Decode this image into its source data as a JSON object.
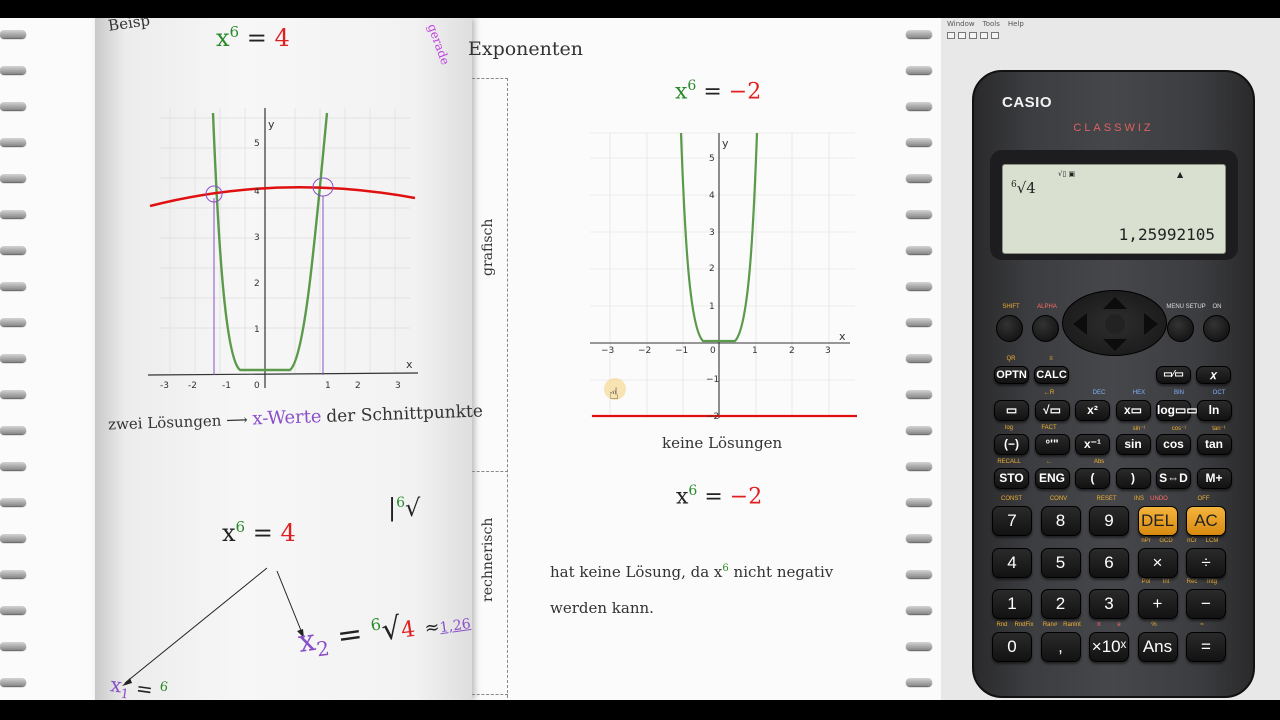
{
  "notebook": {
    "top_left_text": "Beisp",
    "vertical_header": "gerade",
    "header_right": "Exponenten",
    "left_equation": {
      "base": "x",
      "exp": "6",
      "eq": "=",
      "rhs": "4"
    },
    "left_caption_pre": "zwei Lösungen",
    "left_caption_highlight": "x-Werte",
    "left_caption_post": "der Schnittpunkte",
    "label_grafisch": "grafisch",
    "label_rechnerisch": "rechnerisch",
    "right_equation": {
      "base": "x",
      "exp": "6",
      "eq": "=",
      "rhs": "−2"
    },
    "right_caption": "keine Lösungen",
    "right_equation2": {
      "base": "x",
      "exp": "6",
      "eq": "=",
      "rhs": "−2"
    },
    "explanation_line1_a": "hat keine Lösung, da x",
    "explanation_line1_exp": "6",
    "explanation_line1_b": " nicht negativ",
    "explanation_line2": "werden kann.",
    "calc_work": {
      "eq_base": "x",
      "eq_exp": "6",
      "eq_eq": "=",
      "eq_rhs": "4",
      "root_index": "6",
      "x2_label": "x",
      "x2_sub": "2",
      "x2_eq": "=",
      "x2_root_index": "6",
      "x2_radicand": "4",
      "approx": "≈",
      "approx_value": "1,26",
      "x1_label": "x",
      "x1_sub": "1",
      "x1_eq": "=",
      "x1_frag": "6"
    },
    "graph_left": {
      "axis_x": "x",
      "axis_y": "y",
      "x_ticks": [
        "-3",
        "-2",
        "-1",
        "0",
        "1",
        "2",
        "3"
      ],
      "y_ticks": [
        "1",
        "2",
        "3",
        "4",
        "5"
      ]
    },
    "graph_right": {
      "axis_x": "x",
      "axis_y": "y",
      "x_ticks": [
        "−3",
        "−2",
        "−1",
        "0",
        "1",
        "2",
        "3"
      ],
      "y_ticks_pos": [
        "1",
        "2",
        "3",
        "4",
        "5"
      ],
      "y_ticks_neg": [
        "−1",
        "−2"
      ]
    }
  },
  "calculator_window": {
    "menu": [
      "Window",
      "Tools",
      "Help"
    ],
    "brand": "CASIO",
    "model": "CLASSWIZ",
    "display": {
      "indicators": "√▯ ▣",
      "arrow": "▲",
      "input_index": "6",
      "input_radical": "√4",
      "result": "1,25992105"
    },
    "top_labels": {
      "shift": "SHIFT",
      "alpha": "ALPHA",
      "menu": "MENU SETUP",
      "on": "ON"
    },
    "rows": [
      [
        "OPTN",
        "CALC",
        "",
        "",
        "",
        ""
      ],
      [
        "▭",
        "√▭",
        "x²",
        "x▭",
        "log▭▭",
        "ln"
      ],
      [
        "(−)",
        "°'\"",
        "x⁻¹",
        "sin",
        "cos",
        "tan"
      ],
      [
        "STO",
        "ENG",
        "(",
        ")",
        "S⇔D",
        "M+"
      ],
      [
        "7",
        "8",
        "9",
        "DEL",
        "AC"
      ],
      [
        "4",
        "5",
        "6",
        "×",
        "÷"
      ],
      [
        "1",
        "2",
        "3",
        "+",
        "−"
      ],
      [
        "0",
        ",",
        "×10ˣ",
        "Ans",
        "="
      ]
    ],
    "extra_keys": {
      "fraction": "▭⁄▭",
      "x": "𝑥"
    },
    "shift_labels": {
      "r1": [
        "QR",
        "≡"
      ],
      "r2": [
        "←R",
        "DEC",
        "HEX",
        "BIN",
        "OCT"
      ],
      "r3": [
        "log",
        "FACT",
        "sin⁻¹",
        "cos⁻¹",
        "tan⁻¹"
      ],
      "r4": [
        "RECALL",
        "←",
        "Abs",
        "",
        ""
      ],
      "r5": [
        "CONST",
        "CONV",
        "RESET",
        "INS",
        "UNDO",
        "OFF"
      ],
      "r6": [
        "nPr",
        "GCD",
        "nCr",
        "LCM"
      ],
      "r7": [
        "Pol",
        "Int",
        "Rec",
        "Intg"
      ],
      "r8": [
        "Rnd",
        "RndFix",
        "Ran#",
        "RanInt",
        "π",
        "e",
        "%",
        "≈"
      ]
    }
  },
  "colors": {
    "graph_green": "#5a9a4a",
    "graph_red": "#e01010",
    "accent_purple": "#8a4fc8",
    "rhs_red": "#e02020",
    "exp_green": "#3a9a3a"
  }
}
